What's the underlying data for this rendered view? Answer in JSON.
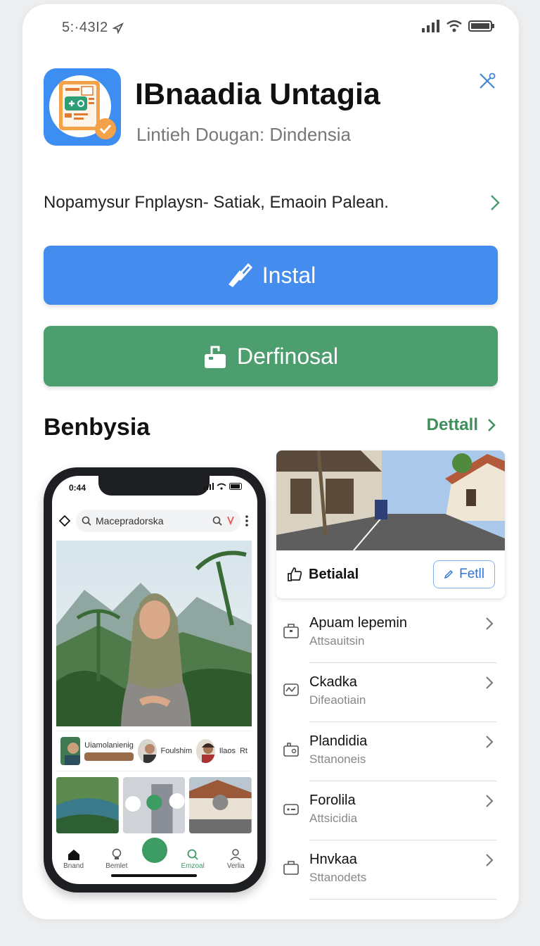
{
  "status_bar": {
    "time": "5:·43I2"
  },
  "app": {
    "title": "IBnaadia Untagia",
    "subtitle": "Lintieh Dougan: Dindensia",
    "description": "Nopamysur Fnplaysn- Satiak, Emaoin Palean."
  },
  "buttons": {
    "install_label": "Instal",
    "second_label": "Derfinosal"
  },
  "section": {
    "title": "Benbysia",
    "link_label": "Dettall"
  },
  "phone": {
    "time": "0:44",
    "search_text": "Macepradorska",
    "mid_label": "Uiamolanienig",
    "mid_caption_1": "Foulshim",
    "mid_caption_2": "Ilaos",
    "mid_caption_3": "Rt",
    "nav": [
      "Bnand",
      "Bemlet",
      "Emzoal",
      "Verlia"
    ]
  },
  "feature_card": {
    "label": "Betialal",
    "button_label": "Fetll"
  },
  "list": [
    {
      "title": "Apuam lepemin",
      "subtitle": "Attsauitsin",
      "icon": "box-icon"
    },
    {
      "title": "Ckadka",
      "subtitle": "Difeaotiain",
      "icon": "wave-icon"
    },
    {
      "title": "Plandidia",
      "subtitle": "Sttanoneis",
      "icon": "bag-icon"
    },
    {
      "title": "Forolila",
      "subtitle": "Attsicidia",
      "icon": "briefcase-icon"
    },
    {
      "title": "Hnvkaa",
      "subtitle": "Sttanodets",
      "icon": "box-icon"
    }
  ],
  "colors": {
    "install": "#448cee",
    "second": "#4d9e6e",
    "link": "#3f8f5c"
  }
}
